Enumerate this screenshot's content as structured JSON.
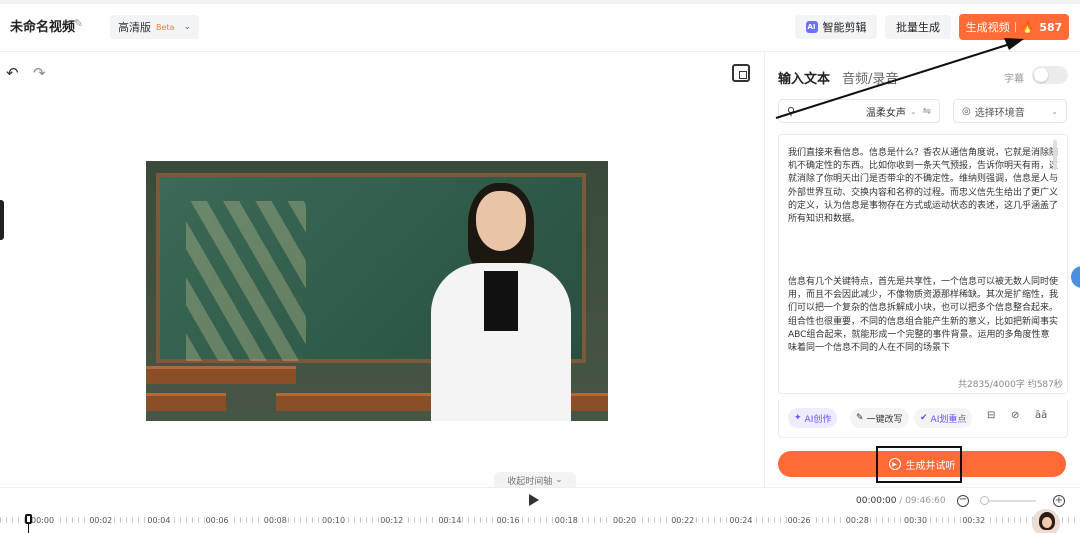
{
  "header": {
    "title": "未命名视频",
    "quality": "高清版",
    "quality_badge": "Beta",
    "smart_edit": "智能剪辑",
    "batch": "批量生成",
    "generate": "生成视频",
    "credits": "587"
  },
  "panel": {
    "tab_text": "输入文本",
    "tab_audio": "音频/录音",
    "subtitle_toggle": "字幕",
    "voice": "温柔女声",
    "environment": "选择环境音",
    "paragraph1": "我们直接来看信息。信息是什么？香农从通信角度说，它就是消除随机不确定性的东西。比如你收到一条天气预报，告诉你明天有雨，这就消除了你明天出门是否带伞的不确定性。维纳则强调，信息是人与外部世界互动、交换内容和名称的过程。而忠义信先生给出了更广义的定义，认为信息是事物存在方式或运动状态的表述，这几乎涵盖了所有知识和数据。",
    "paragraph2": "信息有几个关键特点，首先是共享性，一个信息可以被无数人同时使用，而且不会因此减少，不像物质资源那样稀缺。其次是扩缩性，我们可以把一个复杂的信息拆解成小块，也可以把多个信息整合起来。组合性也很重要，不同的信息组合能产生新的意义，比如把新闻事实ABC组合起来，就能形成一个完整的事件背景。运用的多角度性意味着同一个信息不同的人在不同的场景下",
    "count": "共2835/4000字 约587秒",
    "tool_ai": "AI创作",
    "tool_rewrite": "一键改写",
    "tool_keypoint": "AI划重点",
    "tool_font": "āā",
    "listen": "生成并试听"
  },
  "canvas": {
    "collapse_timeline": "收起时间轴"
  },
  "playback": {
    "current": "00:00:00",
    "duration": "/ 09:46:60"
  },
  "ruler": [
    "00:00",
    "00:02",
    "00:04",
    "00:06",
    "00:08",
    "00:10",
    "00:12",
    "00:14",
    "00:16",
    "00:18",
    "00:20",
    "00:22",
    "00:24",
    "00:26",
    "00:28",
    "00:30",
    "00:32"
  ],
  "colors": {
    "accent": "#ff6a36",
    "ai": "#6a4cff"
  },
  "icons": [
    "undo-icon",
    "redo-icon",
    "layout-icon",
    "edit-icon",
    "play-icon",
    "zoom-out-icon",
    "zoom-in-icon",
    "user-icon",
    "adjust-icon",
    "music-icon"
  ]
}
